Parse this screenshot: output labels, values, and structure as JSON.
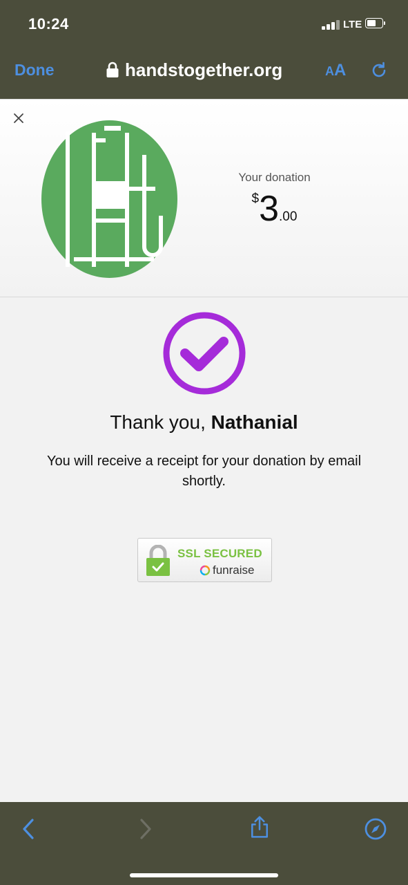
{
  "status_bar": {
    "time": "10:24",
    "network": "LTE"
  },
  "browser": {
    "done_label": "Done",
    "url": "handstogether.org",
    "text_size_small": "A",
    "text_size_large": "A",
    "accent_color": "#4d8fe0"
  },
  "donation": {
    "label": "Your donation",
    "currency_symbol": "$",
    "amount_whole": "3",
    "amount_cents": ".00"
  },
  "confirmation": {
    "thanks_prefix": "Thank you, ",
    "donor_name": "Nathanial",
    "receipt_message": "You will receive a receipt for your donation by email shortly.",
    "check_color": "#a52bd9"
  },
  "ssl_badge": {
    "title": "SSL SECURED",
    "provider": "funraise",
    "title_color": "#7ac142"
  },
  "logo": {
    "color": "#5aaa5e"
  },
  "toolbar": {
    "icons": [
      "back-icon",
      "forward-icon",
      "share-icon",
      "compass-icon"
    ]
  }
}
